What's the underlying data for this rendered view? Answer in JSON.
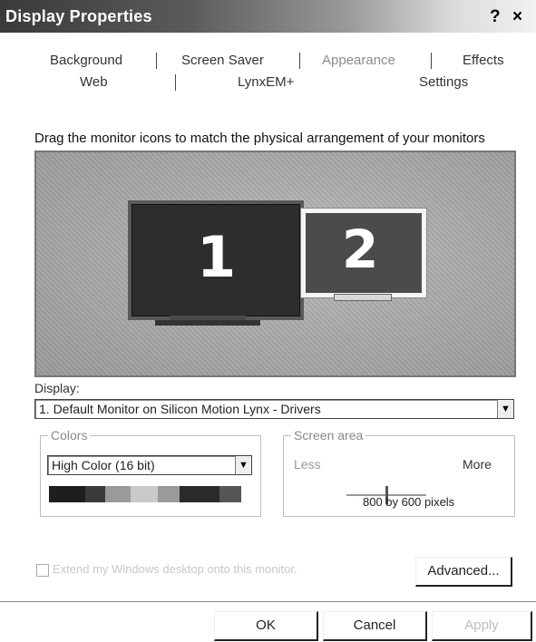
{
  "window": {
    "title": "Display Properties",
    "help_label": "?",
    "close_label": "×"
  },
  "tabs": {
    "row1": [
      "Background",
      "Screen Saver",
      "Appearance",
      "Effects"
    ],
    "row2": [
      "Web",
      "LynxEM+",
      "Settings"
    ],
    "active": "Settings"
  },
  "hint": "Drag the monitor icons to match the physical arrangement of your monitors",
  "monitors": [
    {
      "number": "1",
      "selected": true
    },
    {
      "number": "2",
      "selected": false
    }
  ],
  "display": {
    "label": "Display:",
    "value": "1. Default Monitor on Silicon Motion Lynx - Drivers"
  },
  "colors": {
    "caption": "Colors",
    "value": "High Color (16 bit)",
    "palette": [
      "#1e1e1e",
      "#3a3a3a",
      "#9a9a9a",
      "#c9c9c9",
      "#9a9a9a",
      "#2a2a2a",
      "#555555"
    ]
  },
  "screen_area": {
    "caption": "Screen area",
    "less_label": "Less",
    "more_label": "More",
    "resolution": "800 by 600 pixels",
    "level": 0.5
  },
  "extend_checkbox": {
    "label": "Extend my Windows desktop onto this monitor.",
    "checked": false,
    "enabled": false
  },
  "buttons": {
    "advanced": "Advanced...",
    "ok": "OK",
    "cancel": "Cancel",
    "apply": "Apply"
  }
}
